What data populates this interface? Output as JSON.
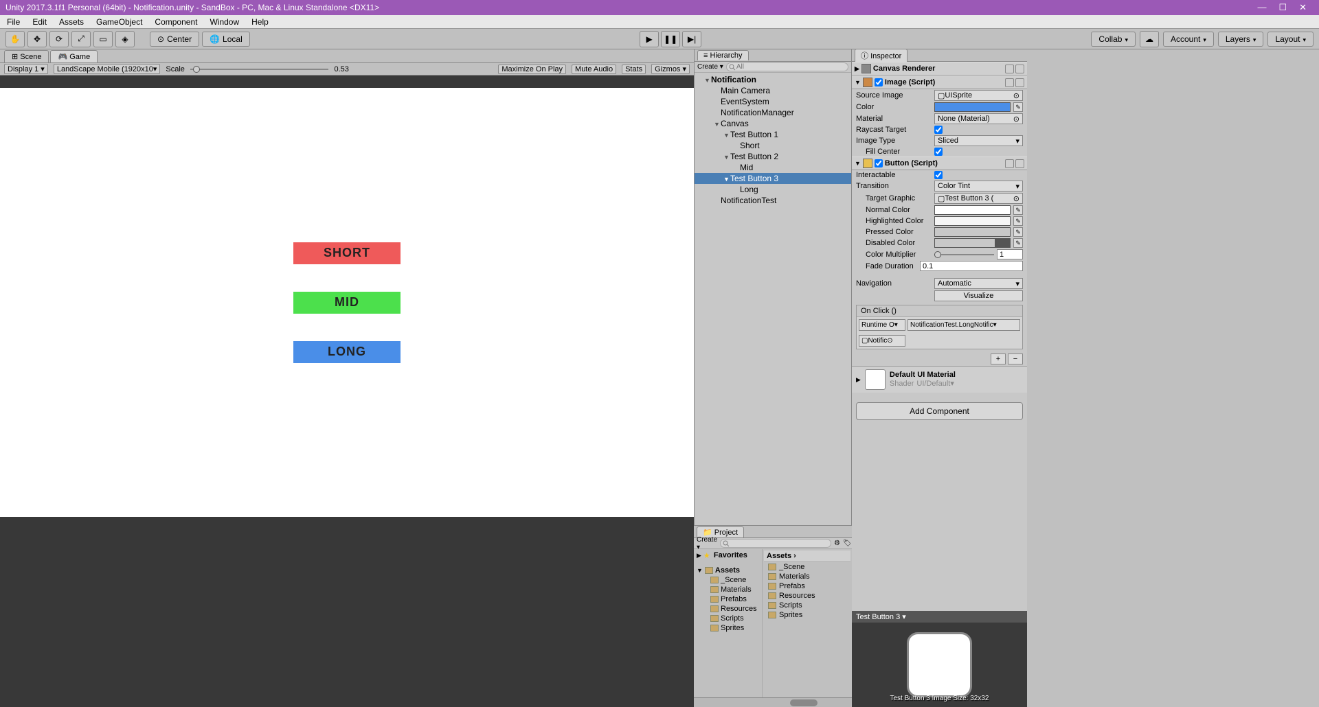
{
  "titlebar": {
    "title": "Unity 2017.3.1f1 Personal (64bit) - Notification.unity - SandBox - PC, Mac & Linux Standalone <DX11>"
  },
  "menu": [
    "File",
    "Edit",
    "Assets",
    "GameObject",
    "Component",
    "Window",
    "Help"
  ],
  "toolbar": {
    "pivot": "Center",
    "space": "Local",
    "collab": "Collab",
    "account": "Account",
    "layers": "Layers",
    "layout": "Layout"
  },
  "gameTabs": {
    "scene": "Scene",
    "game": "Game"
  },
  "gameBar": {
    "display": "Display 1",
    "aspect": "LandScape Mobile (1920x10",
    "scaleLabel": "Scale",
    "scaleValue": "0.53",
    "maxOnPlay": "Maximize On Play",
    "muteAudio": "Mute Audio",
    "stats": "Stats",
    "gizmos": "Gizmos"
  },
  "gameButtons": {
    "short": "SHORT",
    "mid": "MID",
    "long": "LONG"
  },
  "hierarchy": {
    "title": "Hierarchy",
    "create": "Create",
    "searchPlaceholder": "All",
    "items": [
      {
        "label": "Notification",
        "indent": 0,
        "arrow": "▼",
        "bold": true
      },
      {
        "label": "Main Camera",
        "indent": 1
      },
      {
        "label": "EventSystem",
        "indent": 1
      },
      {
        "label": "NotificationManager",
        "indent": 1
      },
      {
        "label": "Canvas",
        "indent": 1,
        "arrow": "▼"
      },
      {
        "label": "Test Button 1",
        "indent": 2,
        "arrow": "▼"
      },
      {
        "label": "Short",
        "indent": 3
      },
      {
        "label": "Test Button 2",
        "indent": 2,
        "arrow": "▼"
      },
      {
        "label": "Mid",
        "indent": 3
      },
      {
        "label": "Test Button 3",
        "indent": 2,
        "arrow": "▼",
        "selected": true
      },
      {
        "label": "Long",
        "indent": 3
      },
      {
        "label": "NotificationTest",
        "indent": 1
      }
    ]
  },
  "project": {
    "title": "Project",
    "create": "Create",
    "favorites": "Favorites",
    "assets": "Assets",
    "folders": [
      "_Scene",
      "Materials",
      "Prefabs",
      "Resources",
      "Scripts",
      "Sprites"
    ],
    "breadcrumb": "Assets ›",
    "listFolders": [
      "_Scene",
      "Materials",
      "Prefabs",
      "Resources",
      "Scripts",
      "Sprites"
    ]
  },
  "inspector": {
    "title": "Inspector",
    "canvasRenderer": {
      "name": "Canvas Renderer"
    },
    "image": {
      "name": "Image (Script)",
      "sourceImageLabel": "Source Image",
      "sourceImage": "UISprite",
      "colorLabel": "Color",
      "colorVal": "#4a8ee8",
      "materialLabel": "Material",
      "material": "None (Material)",
      "raycastLabel": "Raycast Target",
      "imageTypeLabel": "Image Type",
      "imageType": "Sliced",
      "fillCenterLabel": "Fill Center"
    },
    "button": {
      "name": "Button (Script)",
      "interactableLabel": "Interactable",
      "transitionLabel": "Transition",
      "transition": "Color Tint",
      "targetGraphicLabel": "Target Graphic",
      "targetGraphic": "Test Button 3 (",
      "normalColorLabel": "Normal Color",
      "normalColor": "#ffffff",
      "highlightedColorLabel": "Highlighted Color",
      "highlightedColor": "#f5f5f5",
      "pressedColorLabel": "Pressed Color",
      "pressedColor": "#c8c8c8",
      "disabledColorLabel": "Disabled Color",
      "disabledColor": "#c8c8c8",
      "colorMultiplierLabel": "Color Multiplier",
      "colorMultiplier": "1",
      "fadeDurationLabel": "Fade Duration",
      "fadeDuration": "0.1",
      "navigationLabel": "Navigation",
      "navigation": "Automatic",
      "visualize": "Visualize",
      "onClickTitle": "On Click ()",
      "onClickState": "Runtime O",
      "onClickMethod": "NotificationTest.LongNotific",
      "onClickTarget": "Notific"
    },
    "material": {
      "name": "Default UI Material",
      "shaderLabel": "Shader",
      "shader": "UI/Default"
    },
    "addComponent": "Add Component",
    "preview": {
      "title": "Test Button 3",
      "caption": "Test Button 3\nImage Size: 32x32"
    }
  }
}
